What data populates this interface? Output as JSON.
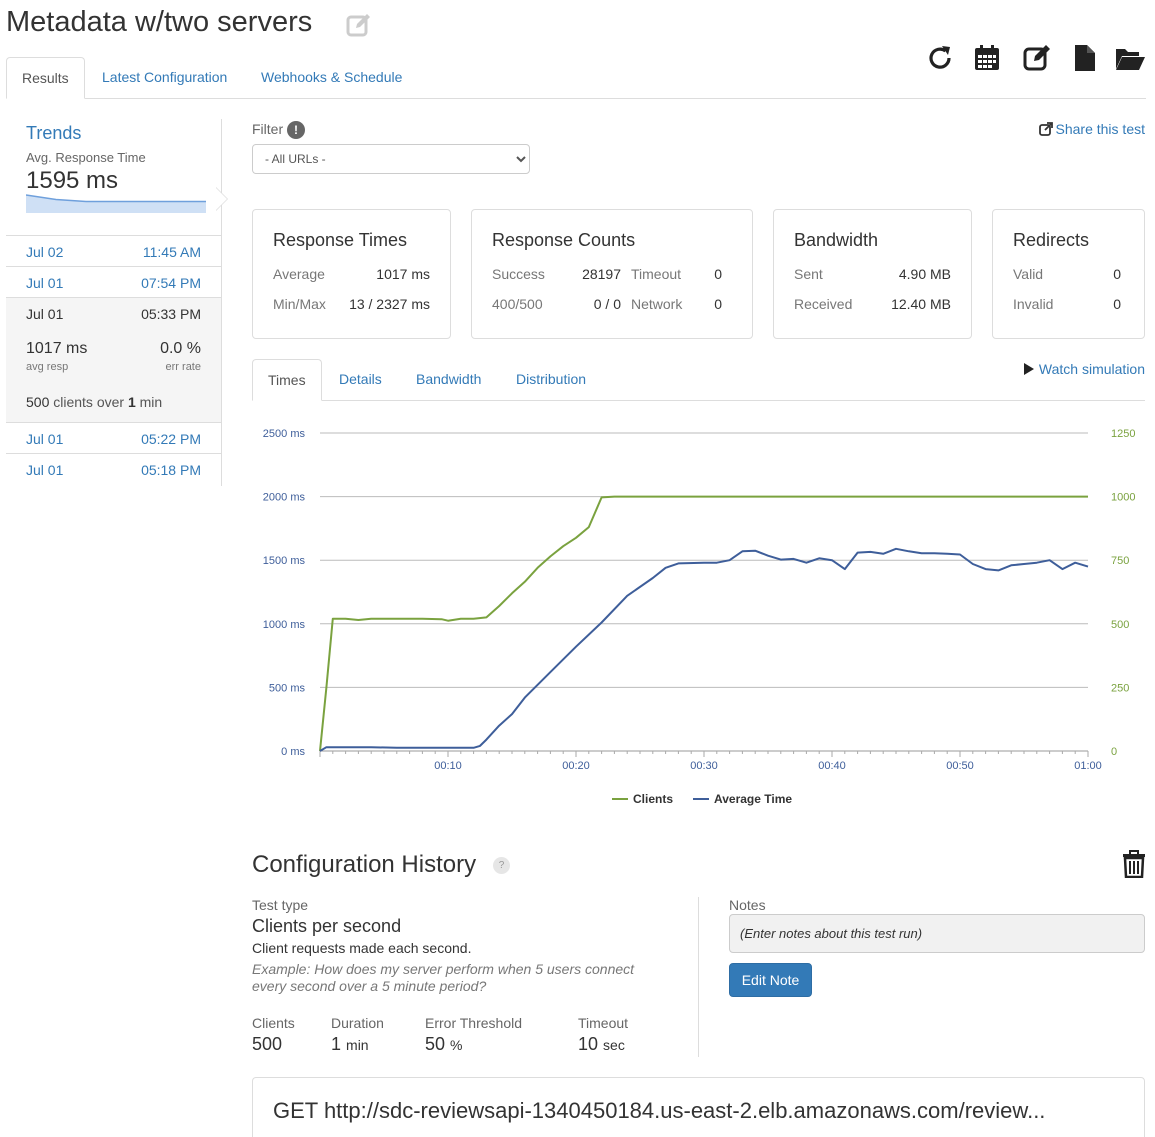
{
  "page": {
    "title": "Metadata w/two servers"
  },
  "top_tabs": [
    "Results",
    "Latest Configuration",
    "Webhooks & Schedule"
  ],
  "toolbar": {
    "icons": [
      "refresh-icon",
      "calendar-icon",
      "edit-icon",
      "file-icon",
      "folder-open-icon"
    ]
  },
  "trends": {
    "title": "Trends",
    "subtitle": "Avg. Response Time",
    "value": "1595 ms",
    "sparkline": [
      1595,
      1200,
      1017,
      1017,
      1017,
      1017,
      1017
    ]
  },
  "runs": [
    {
      "date": "Jul 02",
      "time": "11:45 AM"
    },
    {
      "date": "Jul 01",
      "time": "07:54 PM"
    },
    {
      "date": "Jul 01",
      "time": "05:33 PM",
      "avg_resp": "1017 ms",
      "avg_resp_label": "avg resp",
      "err_rate": "0.0 %",
      "err_rate_label": "err rate",
      "clients": "500",
      "clients_text": "clients over",
      "duration": "1",
      "duration_unit": "min"
    },
    {
      "date": "Jul 01",
      "time": "05:22 PM"
    },
    {
      "date": "Jul 01",
      "time": "05:18 PM"
    }
  ],
  "filter": {
    "label": "Filter",
    "info": "!",
    "selected": "- All URLs -",
    "share": "Share this test"
  },
  "response_times": {
    "title": "Response Times",
    "average_label": "Average",
    "average": "1017 ms",
    "minmax_label": "Min/Max",
    "minmax": "13 / 2327 ms"
  },
  "response_counts": {
    "title": "Response Counts",
    "success_label": "Success",
    "success": "28197",
    "timeout_label": "Timeout",
    "timeout": "0",
    "err_label": "400/500",
    "err": "0 / 0",
    "network_label": "Network",
    "network": "0"
  },
  "bandwidth": {
    "title": "Bandwidth",
    "sent_label": "Sent",
    "sent": "4.90 MB",
    "received_label": "Received",
    "received": "12.40 MB"
  },
  "redirects": {
    "title": "Redirects",
    "valid_label": "Valid",
    "valid": "0",
    "invalid_label": "Invalid",
    "invalid": "0"
  },
  "chart_tabs": [
    "Times",
    "Details",
    "Bandwidth",
    "Distribution"
  ],
  "watch_simulation": "Watch simulation",
  "colors": {
    "clients": "#7aa23f",
    "average_time": "#3e5e9a",
    "link": "#337ab7"
  },
  "chart_data": {
    "type": "line",
    "x_tick_labels": [
      "00:10",
      "00:20",
      "00:30",
      "00:40",
      "00:50",
      "01:00"
    ],
    "y_left_tick_labels": [
      "0 ms",
      "500 ms",
      "1000 ms",
      "1500 ms",
      "2000 ms",
      "2500 ms"
    ],
    "y_right_tick_labels": [
      "0",
      "250",
      "500",
      "750",
      "1000",
      "1250"
    ],
    "ylim_left": [
      0,
      2500
    ],
    "ylim_right": [
      0,
      1250
    ],
    "xlim": [
      0,
      60
    ],
    "grid": true,
    "legend_position": "bottom",
    "series": [
      {
        "name": "Clients",
        "axis": "right",
        "x": [
          0,
          0.5,
          1,
          2,
          3,
          4,
          6,
          8,
          9.5,
          10,
          11,
          12,
          13,
          14,
          15,
          16,
          17,
          18,
          19,
          20,
          21,
          22,
          23,
          25,
          30,
          35,
          40,
          45,
          50,
          55,
          60
        ],
        "y": [
          0,
          250,
          520,
          520,
          515,
          520,
          520,
          520,
          518,
          512,
          520,
          520,
          525,
          570,
          620,
          665,
          720,
          765,
          805,
          838,
          880,
          997,
          1000,
          1000,
          1000,
          1000,
          1000,
          1000,
          1000,
          1000,
          1000
        ]
      },
      {
        "name": "Average Time",
        "axis": "left",
        "x": [
          0,
          0.5,
          1,
          2,
          4,
          6,
          8,
          10,
          12,
          12.5,
          13,
          14,
          15,
          16,
          18,
          20,
          22,
          24,
          26,
          27,
          28,
          30,
          31,
          32,
          33,
          34,
          35,
          36,
          37,
          38,
          39,
          40,
          41,
          42,
          43,
          44,
          45,
          46,
          47,
          48,
          49,
          50,
          51,
          52,
          53,
          54,
          55,
          56,
          57,
          58,
          59,
          60
        ],
        "y": [
          0,
          30,
          30,
          30,
          30,
          25,
          25,
          25,
          25,
          40,
          90,
          200,
          290,
          420,
          620,
          820,
          1010,
          1220,
          1360,
          1440,
          1475,
          1480,
          1480,
          1500,
          1570,
          1575,
          1535,
          1505,
          1510,
          1480,
          1515,
          1500,
          1430,
          1560,
          1565,
          1550,
          1590,
          1570,
          1555,
          1555,
          1550,
          1545,
          1470,
          1430,
          1420,
          1460,
          1470,
          1480,
          1500,
          1430,
          1480,
          1450
        ]
      }
    ]
  },
  "config": {
    "title": "Configuration History",
    "help": "?",
    "test_type_label": "Test type",
    "test_type": "Clients per second",
    "test_type_desc": "Client requests made each second.",
    "test_type_example": "Example: How does my server perform when 5 users connect every second over a 5 minute period?",
    "clients_label": "Clients",
    "clients": "500",
    "duration_label": "Duration",
    "duration": "1",
    "duration_unit": "min",
    "error_threshold_label": "Error Threshold",
    "error_threshold": "50",
    "error_threshold_unit": "%",
    "timeout_label": "Timeout",
    "timeout": "10",
    "timeout_unit": "sec",
    "notes_label": "Notes",
    "notes_placeholder": "(Enter notes about this test run)",
    "edit_note": "Edit Note"
  },
  "request": {
    "url": "GET http://sdc-reviewsapi-1340450184.us-east-2.elb.amazonaws.com/review..."
  }
}
